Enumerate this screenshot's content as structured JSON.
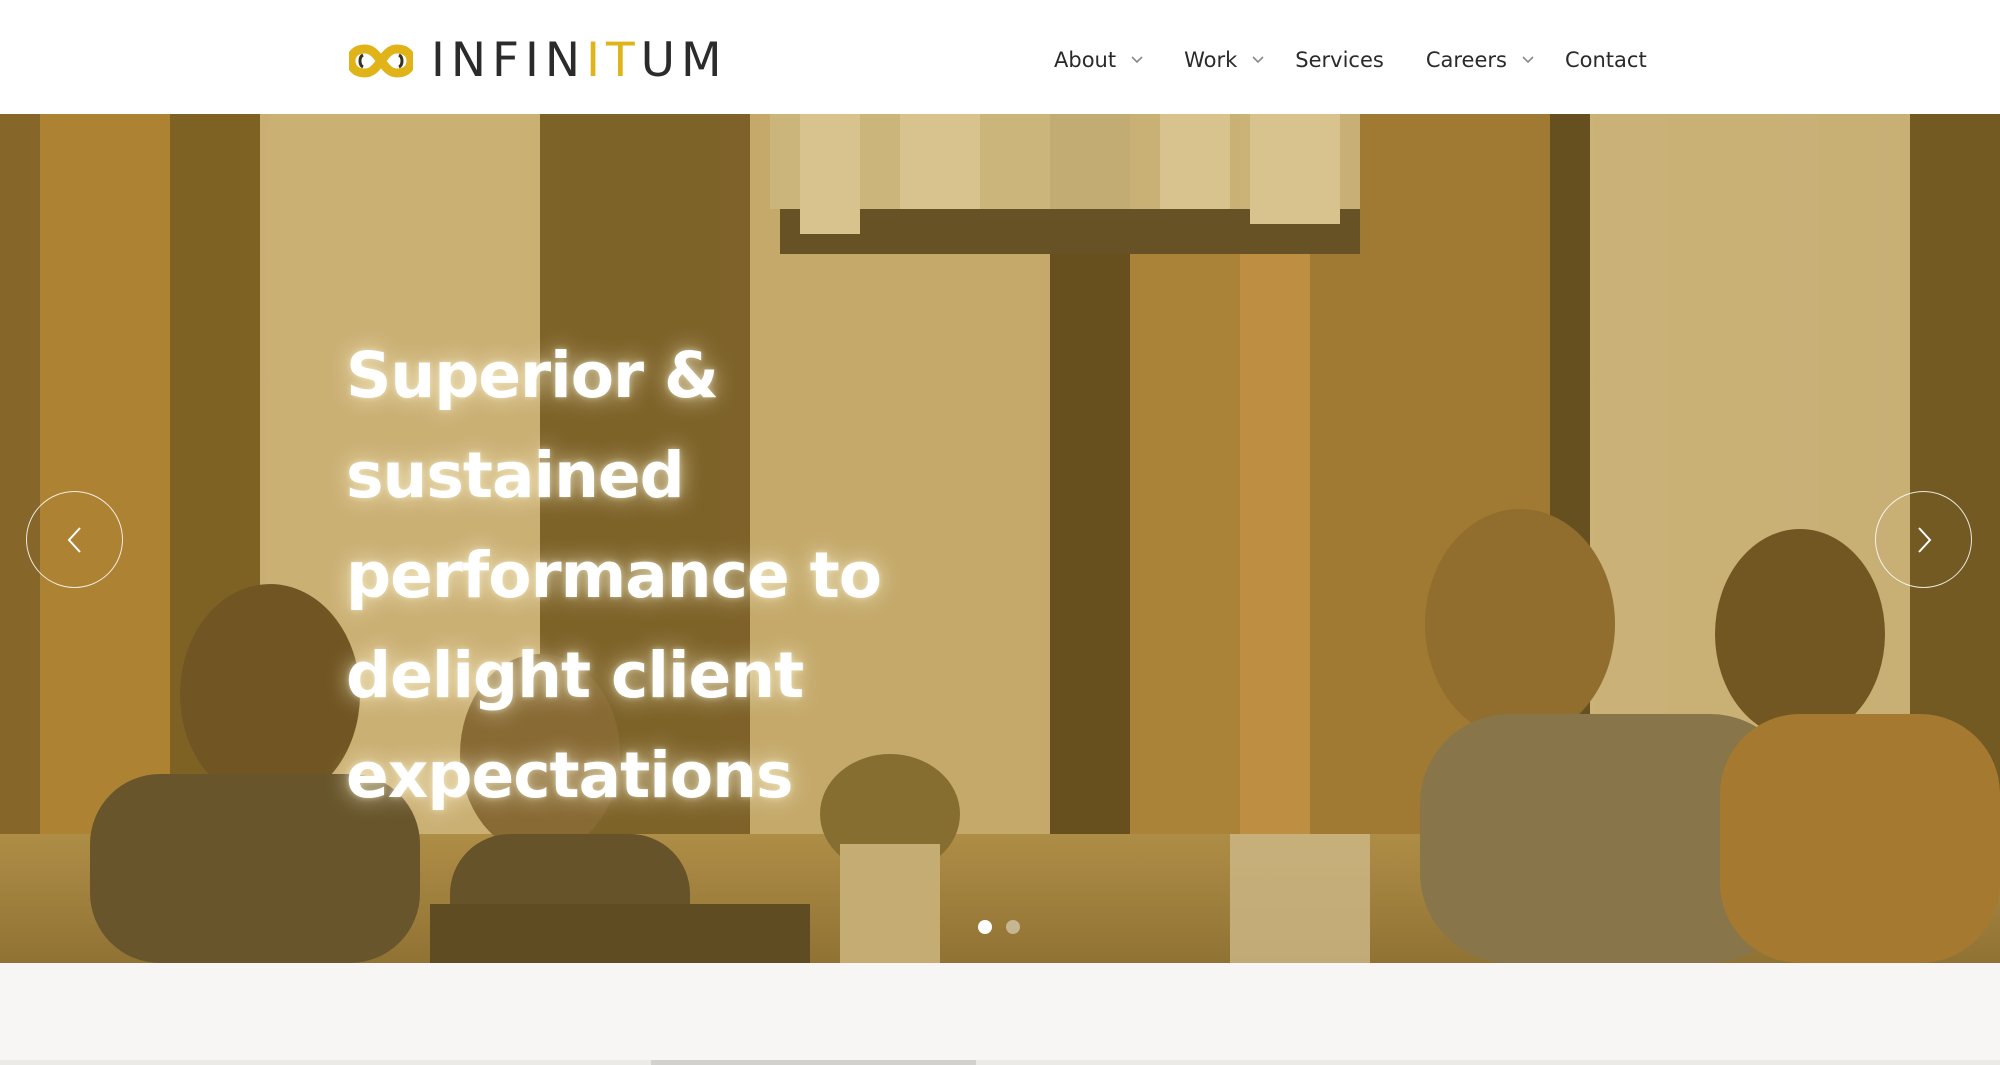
{
  "brand": {
    "name_part1": "INFIN",
    "name_highlight": "IT",
    "name_part2": "UM",
    "colors": {
      "accent": "#e0b418",
      "text": "#2b2b2b"
    },
    "icon": "infinity-logo-icon"
  },
  "nav": {
    "items": [
      {
        "label": "About",
        "has_dropdown": true
      },
      {
        "label": "Work",
        "has_dropdown": true
      },
      {
        "label": "Services",
        "has_dropdown": false
      },
      {
        "label": "Careers",
        "has_dropdown": true
      },
      {
        "label": "Contact",
        "has_dropdown": false
      }
    ]
  },
  "hero": {
    "headline_lines": [
      "Superior &",
      "sustained",
      "performance to",
      "delight client",
      "expectations"
    ],
    "prev_icon": "chevron-left-icon",
    "next_icon": "chevron-right-icon",
    "slides": {
      "count": 2,
      "active": 1
    },
    "tint_color": "#b9963c"
  }
}
